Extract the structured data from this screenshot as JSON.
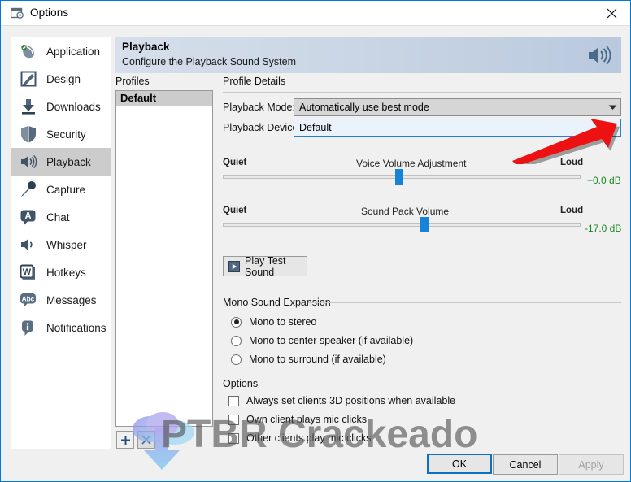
{
  "window": {
    "title": "Options",
    "icon": "options-window-gear-icon",
    "close_label": "Close"
  },
  "sidebar": {
    "items": [
      {
        "label": "Application",
        "icon": "application-icon",
        "selected": false
      },
      {
        "label": "Design",
        "icon": "design-pencil-icon",
        "selected": false
      },
      {
        "label": "Downloads",
        "icon": "download-icon",
        "selected": false
      },
      {
        "label": "Security",
        "icon": "shield-icon",
        "selected": false
      },
      {
        "label": "Playback",
        "icon": "speaker-icon",
        "selected": true
      },
      {
        "label": "Capture",
        "icon": "microphone-icon",
        "selected": false
      },
      {
        "label": "Chat",
        "icon": "chat-bubble-icon",
        "selected": false
      },
      {
        "label": "Whisper",
        "icon": "whisper-speaker-icon",
        "selected": false
      },
      {
        "label": "Hotkeys",
        "icon": "keyboard-w-icon",
        "selected": false
      },
      {
        "label": "Messages",
        "icon": "abc-bubble-icon",
        "selected": false
      },
      {
        "label": "Notifications",
        "icon": "info-bubble-icon",
        "selected": false
      }
    ]
  },
  "banner": {
    "title": "Playback",
    "subtitle": "Configure the Playback Sound System",
    "icon": "speaker-volume-icon"
  },
  "profiles": {
    "section_label": "Profiles",
    "items": [
      {
        "label": "Default",
        "selected": true
      }
    ],
    "add_label": "+",
    "remove_label": "×"
  },
  "details": {
    "section_label": "Profile Details",
    "playback_mode": {
      "label": "Playback Mode:",
      "value": "Automatically use best mode"
    },
    "playback_device": {
      "label": "Playback Device:",
      "value": "Default"
    },
    "voice_volume": {
      "title": "Voice Volume Adjustment",
      "min_label": "Quiet",
      "max_label": "Loud",
      "value_label": "+0.0 dB",
      "percent": 45
    },
    "sound_pack_volume": {
      "title": "Sound Pack Volume",
      "min_label": "Quiet",
      "max_label": "Loud",
      "value_label": "-17.0 dB",
      "percent": 52
    },
    "play_test_sound": "Play Test Sound"
  },
  "mono_group": {
    "label": "Mono Sound Expansion",
    "options": [
      {
        "label": "Mono to stereo",
        "selected": true
      },
      {
        "label": "Mono to center speaker (if available)",
        "selected": false
      },
      {
        "label": "Mono to surround (if available)",
        "selected": false
      }
    ]
  },
  "options_group": {
    "label": "Options",
    "checkboxes": [
      {
        "label": "Always set clients 3D positions when available",
        "checked": false
      },
      {
        "label": "Own client plays mic clicks",
        "checked": false
      },
      {
        "label": "Other clients play mic clicks",
        "checked": false
      }
    ]
  },
  "footer": {
    "ok": "OK",
    "cancel": "Cancel",
    "apply": "Apply"
  },
  "watermark": {
    "text": "PTBR Crackeado",
    "icon": "cloud-download-icon"
  },
  "annotation": {
    "type": "red-arrow",
    "points_to": "playback-device-dropdown-arrow",
    "color": "#ee1111"
  }
}
